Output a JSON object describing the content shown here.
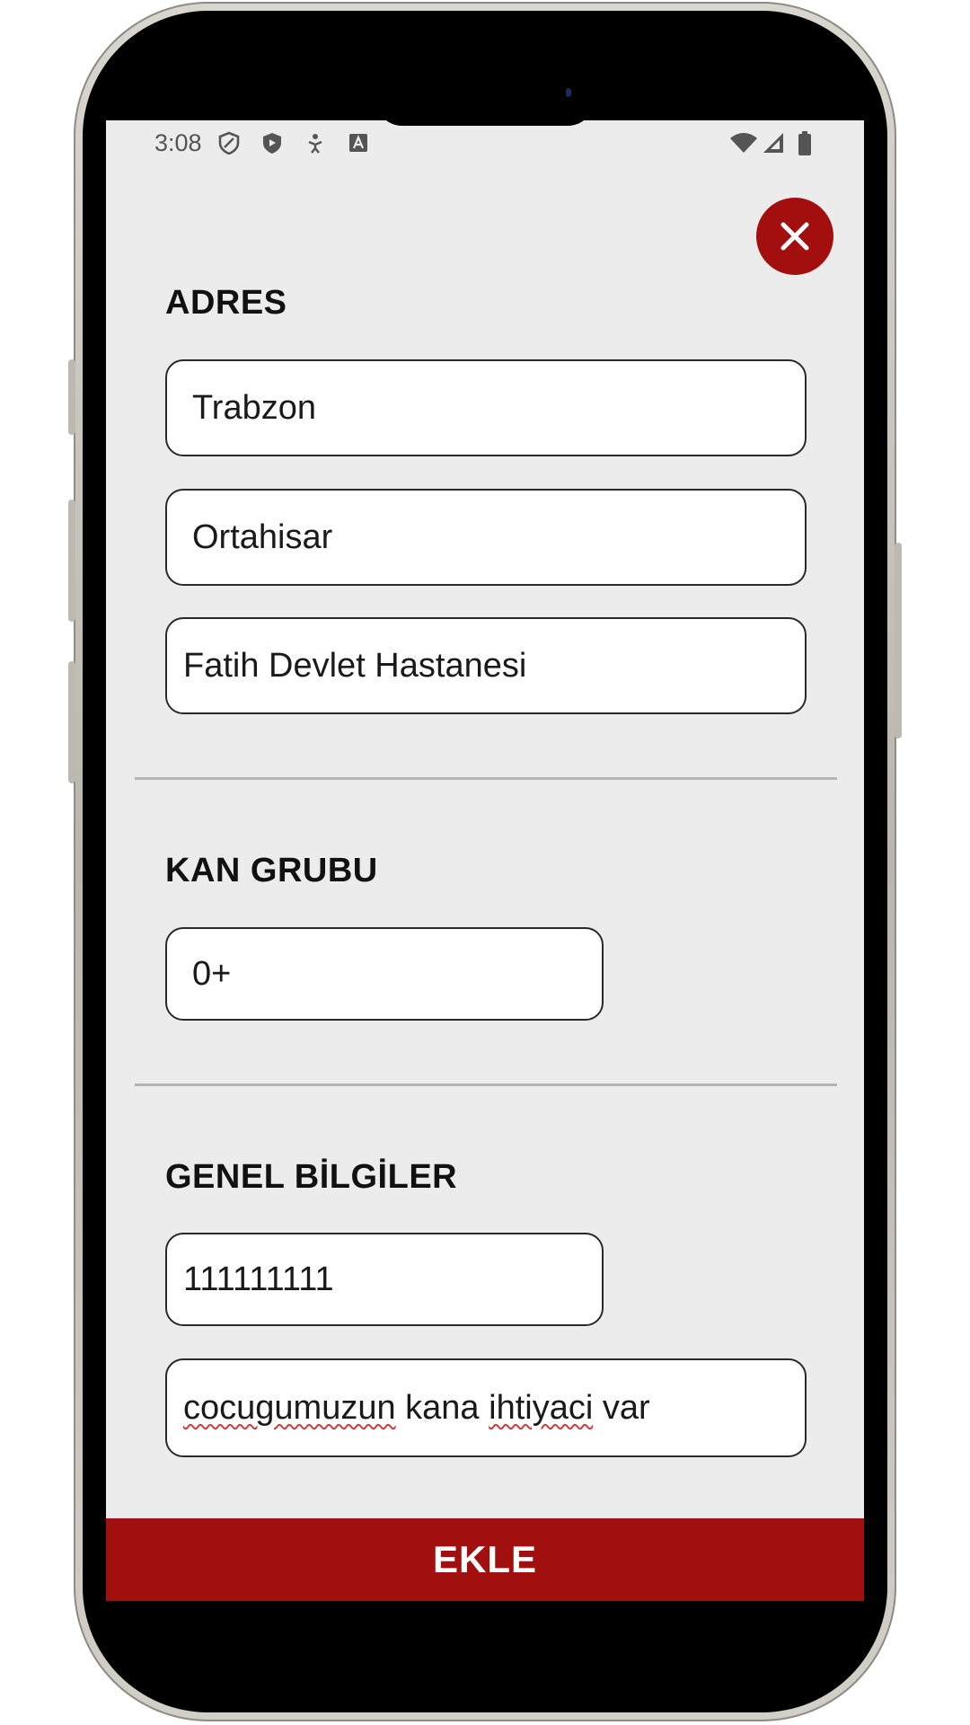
{
  "status_bar": {
    "time": "3:08",
    "left_icons": [
      "shield-outline-icon",
      "shield-play-icon",
      "accessibility-icon",
      "a-box-icon"
    ],
    "right_icons": [
      "wifi-icon",
      "signal-icon",
      "battery-icon"
    ]
  },
  "close_button": {
    "icon": "close-icon"
  },
  "address": {
    "title": "ADRES",
    "city": "Trabzon",
    "district": "Ortahisar",
    "hospital": "Fatih Devlet Hastanesi"
  },
  "blood_group": {
    "title": "KAN GRUBU",
    "value": "0+"
  },
  "general_info": {
    "title": "GENEL BİLGİLER",
    "phone": "111111111",
    "note_words": [
      "cocugumuzun",
      "kana",
      "ihtiyaci",
      "var"
    ]
  },
  "submit": {
    "label": "EKLE"
  },
  "colors": {
    "accent": "#a30f0f",
    "screen_bg": "#ececec",
    "field_bg": "#ffffff",
    "spellcheck": "#d33c3c"
  }
}
